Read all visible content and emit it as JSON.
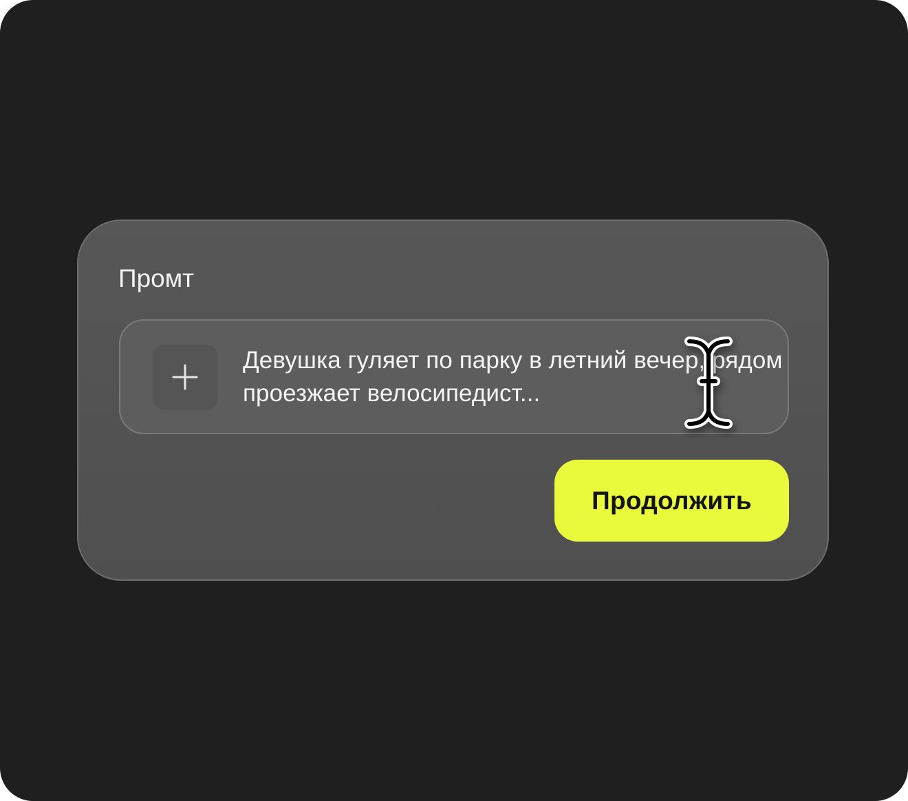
{
  "prompt_panel": {
    "title": "Промт",
    "add_button_icon": "plus-icon",
    "prompt_text": "Девушка гуляет по парку в летний вечер, рядом проезжает велосипедист...",
    "continue_label": "Продолжить"
  },
  "cursor": {
    "icon": "text-cursor-icon"
  },
  "colors": {
    "background": "#1f1f1f",
    "card": "#525252",
    "field": "#5d5d5d",
    "accent": "#e8fa3b"
  }
}
